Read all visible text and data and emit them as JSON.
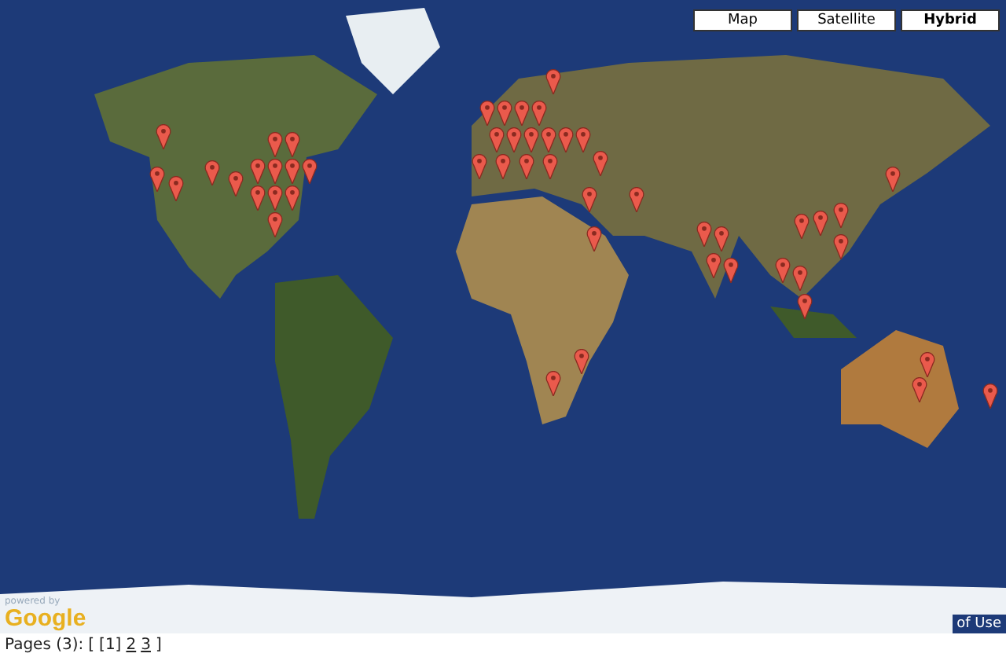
{
  "map": {
    "map_types": [
      {
        "label": "Map",
        "selected": false
      },
      {
        "label": "Satellite",
        "selected": false
      },
      {
        "label": "Hybrid",
        "selected": true
      }
    ],
    "logo": {
      "caption": "powered by",
      "name": "Google"
    },
    "terms": "of Use"
  },
  "pagination": {
    "label": "Pages (3):",
    "open": "[",
    "close": "]",
    "pages": [
      {
        "label": "[1]",
        "selected": true
      },
      {
        "label": "2",
        "selected": false
      },
      {
        "label": "3",
        "selected": false
      }
    ]
  }
}
